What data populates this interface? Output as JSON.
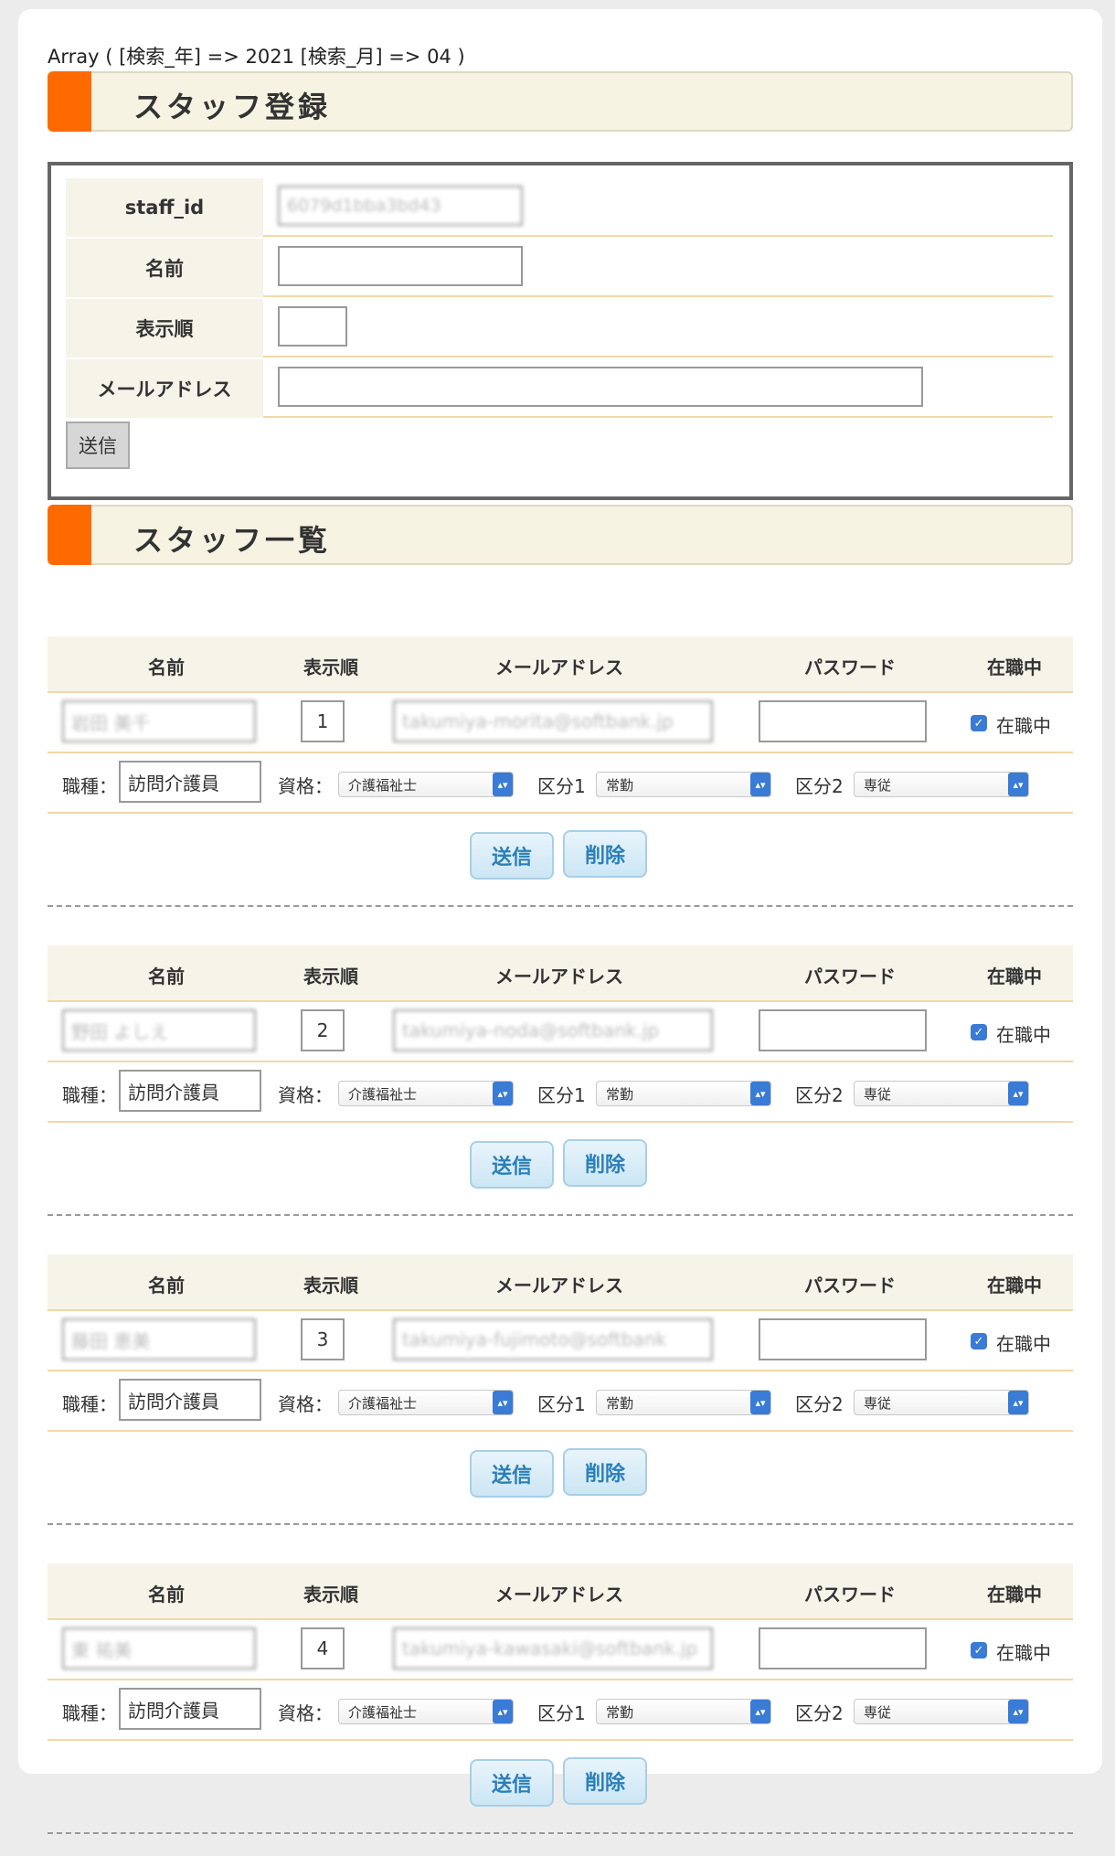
{
  "debug_text": "Array ( [検索_年] => 2021 [検索_月] => 04 )",
  "register": {
    "title": "スタッフ登録",
    "fields": [
      {
        "label": "staff_id",
        "value": "6079d1bba3bd43"
      },
      {
        "label": "名前",
        "value": ""
      },
      {
        "label": "表示順",
        "value": ""
      },
      {
        "label": "メールアドレス",
        "value": ""
      }
    ],
    "submit_label": "送信"
  },
  "list": {
    "title": "スタッフ一覧",
    "headers": {
      "name": "名前",
      "order": "表示順",
      "email": "メールアドレス",
      "password": "パスワード",
      "active": "在職中"
    },
    "labels": {
      "job": "職種：",
      "qualification": "資格：",
      "kubun1": "区分1",
      "kubun2": "区分2",
      "active": "在職中"
    },
    "buttons": {
      "submit": "送信",
      "delete": "削除"
    },
    "staff": [
      {
        "name": "岩田 美千",
        "order": "1",
        "email": "takumiya-morita@softbank.jp",
        "password": "",
        "active": true,
        "job": "訪問介護員",
        "qualification": "介護福祉士",
        "kubun1": "常勤",
        "kubun2": "専従"
      },
      {
        "name": "野田 よしえ",
        "order": "2",
        "email": "takumiya-noda@softbank.jp",
        "password": "",
        "active": true,
        "job": "訪問介護員",
        "qualification": "介護福祉士",
        "kubun1": "常勤",
        "kubun2": "専従"
      },
      {
        "name": "藤田 恵美",
        "order": "3",
        "email": "takumiya-fujimoto@softbank",
        "password": "",
        "active": true,
        "job": "訪問介護員",
        "qualification": "介護福祉士",
        "kubun1": "常勤",
        "kubun2": "専従"
      },
      {
        "name": "東 祐美",
        "order": "4",
        "email": "takumiya-kawasaki@softbank.jp",
        "password": "",
        "active": true,
        "job": "訪問介護員",
        "qualification": "介護福祉士",
        "kubun1": "常勤",
        "kubun2": "専従"
      }
    ]
  },
  "colors": {
    "accent": "#ff6a00",
    "header_bg": "#f6f3e3",
    "button_text": "#2a7fb8",
    "checkbox": "#3a7bd5"
  },
  "icons": {
    "checkbox": "checkmark-icon",
    "select": "chevron-updown-icon"
  }
}
